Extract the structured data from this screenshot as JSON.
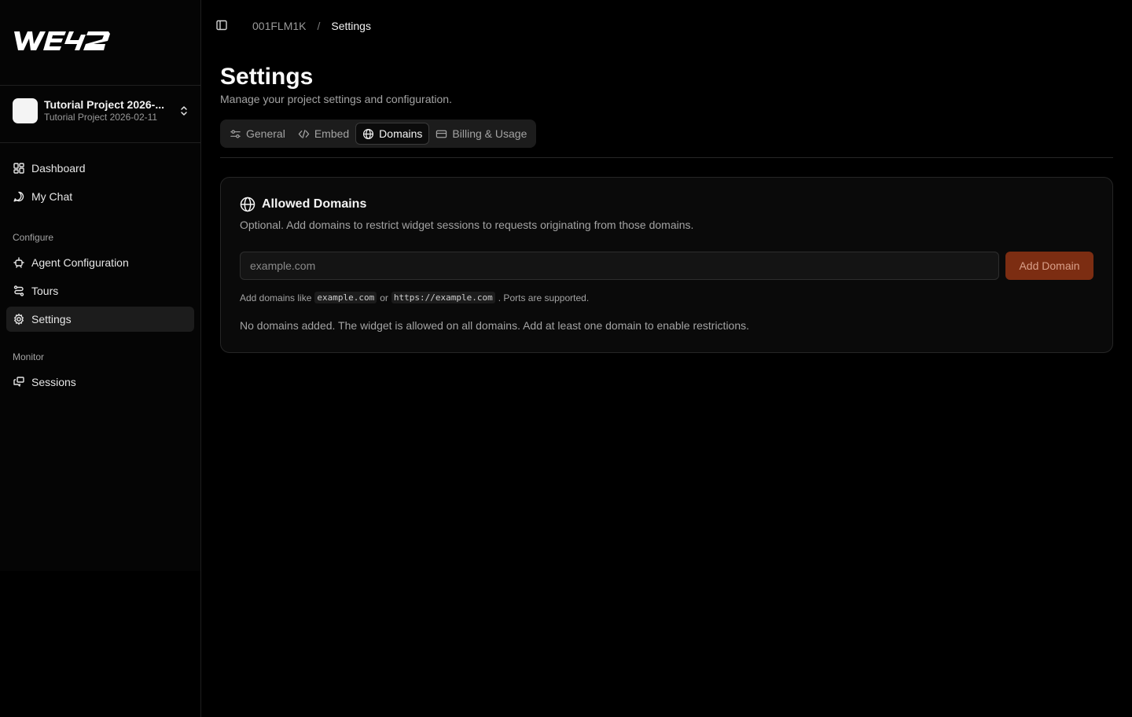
{
  "sidebar": {
    "logo_text": "WE42",
    "project": {
      "name": "Tutorial Project 2026-...",
      "subtitle": "Tutorial Project 2026-02-11"
    },
    "nav": [
      {
        "label": "Dashboard",
        "icon": "dashboard-icon"
      },
      {
        "label": "My Chat",
        "icon": "chat-icon"
      }
    ],
    "groups": {
      "configure": {
        "title": "Configure",
        "items": [
          {
            "label": "Agent Configuration",
            "icon": "bot-icon"
          },
          {
            "label": "Tours",
            "icon": "route-icon"
          },
          {
            "label": "Settings",
            "icon": "gear-icon",
            "active": true
          }
        ]
      },
      "monitor": {
        "title": "Monitor",
        "items": [
          {
            "label": "Sessions",
            "icon": "sessions-icon"
          }
        ]
      }
    }
  },
  "breadcrumb": {
    "parent": "001FLM1K",
    "separator": "/",
    "current": "Settings"
  },
  "page": {
    "title": "Settings",
    "subtitle": "Manage your project settings and configuration."
  },
  "tabs": [
    {
      "label": "General",
      "icon": "sliders-icon"
    },
    {
      "label": "Embed",
      "icon": "code-icon"
    },
    {
      "label": "Domains",
      "icon": "globe-icon",
      "active": true
    },
    {
      "label": "Billing & Usage",
      "icon": "credit-card-icon"
    }
  ],
  "domains_card": {
    "title": "Allowed Domains",
    "description": "Optional. Add domains to restrict widget sessions to requests originating from those domains.",
    "input_value": "",
    "input_placeholder": "example.com",
    "add_button": "Add Domain",
    "hint": {
      "prefix": "Add domains like",
      "example1": "example.com",
      "or": "or",
      "example2": "https://example.com",
      "suffix": ". Ports are supported."
    },
    "empty_message": "No domains added. The widget is allowed on all domains. Add at least one domain to enable restrictions."
  },
  "colors": {
    "accent": "#7c2d12",
    "background": "#000000",
    "card": "#0a0a0a"
  }
}
